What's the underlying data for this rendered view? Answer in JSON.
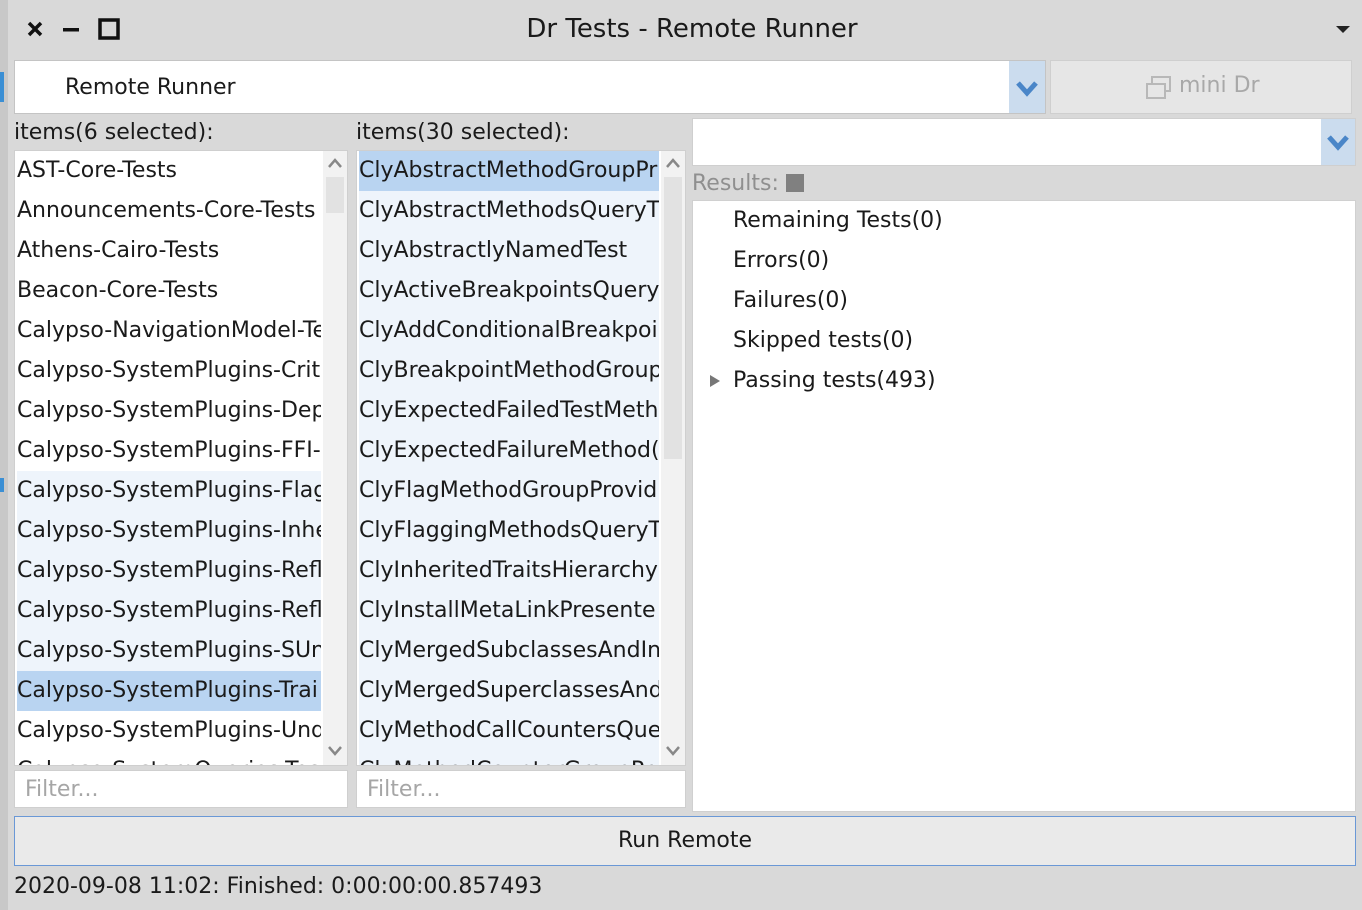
{
  "window": {
    "title": "Dr Tests - Remote Runner",
    "close_glyph": "✕",
    "minimize_glyph": "—",
    "maximize_glyph": "☐"
  },
  "plugin_dropdown": {
    "selected": "Remote Runner"
  },
  "mini_dr_button": {
    "label": "mini Dr"
  },
  "packages_list": {
    "header": "items(6 selected):",
    "filter_placeholder": "Filter...",
    "items": [
      "AST-Core-Tests",
      "Announcements-Core-Tests",
      "Athens-Cairo-Tests",
      "Beacon-Core-Tests",
      "Calypso-NavigationModel-Te",
      "Calypso-SystemPlugins-Criti",
      "Calypso-SystemPlugins-Dep",
      "Calypso-SystemPlugins-FFI-(",
      "Calypso-SystemPlugins-Flag",
      "Calypso-SystemPlugins-Inhe",
      "Calypso-SystemPlugins-Refl",
      "Calypso-SystemPlugins-Refl",
      "Calypso-SystemPlugins-SUn",
      "Calypso-SystemPlugins-Trai",
      "Calypso-SystemPlugins-Und",
      "Calypso-SystemQueries-Tes"
    ]
  },
  "classes_list": {
    "header": "items(30 selected):",
    "filter_placeholder": "Filter...",
    "items": [
      "ClyAbstractMethodGroupPr",
      "ClyAbstractMethodsQueryT",
      "ClyAbstractlyNamedTest",
      "ClyActiveBreakpointsQuery",
      "ClyAddConditionalBreakpoi",
      "ClyBreakpointMethodGroup",
      "ClyExpectedFailedTestMeth",
      "ClyExpectedFailureMethod(",
      "ClyFlagMethodGroupProvid",
      "ClyFlaggingMethodsQueryT",
      "ClyInheritedTraitsHierarchy",
      "ClyInstallMetaLinkPresente",
      "ClyMergedSubclassesAndIn",
      "ClyMergedSuperclassesAnd",
      "ClyMethodCallCountersQue",
      "ClyMethodCounterGroupPr"
    ]
  },
  "results": {
    "label": "Results:",
    "items": [
      {
        "label": "Remaining Tests(0)",
        "expandable": false
      },
      {
        "label": "Errors(0)",
        "expandable": false
      },
      {
        "label": "Failures(0)",
        "expandable": false
      },
      {
        "label": "Skipped tests(0)",
        "expandable": false
      },
      {
        "label": "Passing tests(493)",
        "expandable": true
      }
    ]
  },
  "run_button": {
    "label": "Run Remote"
  },
  "status": {
    "text": "2020-09-08 11:02: Finished: 0:00:00:00.857493"
  },
  "colors": {
    "selection": "#b9d4f1",
    "alt_row": "#eef4fb",
    "dropdown_arrow": "#4a86c8",
    "run_button_border": "#6a98d6"
  }
}
